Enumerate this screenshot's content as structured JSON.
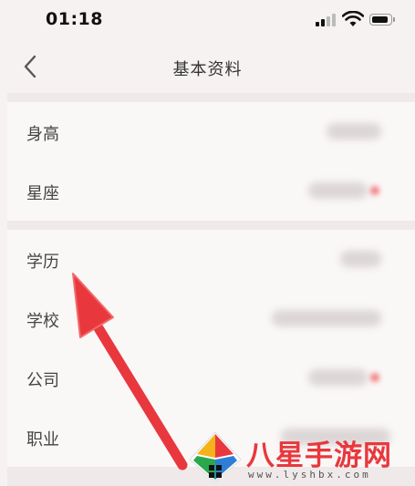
{
  "status_bar": {
    "time": "01:18"
  },
  "nav": {
    "title": "基本资料"
  },
  "rows": [
    {
      "label": "身高"
    },
    {
      "label": "星座"
    },
    {
      "label": "学历"
    },
    {
      "label": "学校"
    },
    {
      "label": "公司"
    },
    {
      "label": "职业"
    }
  ],
  "watermark": {
    "brand": "八星手游网",
    "url": "www.lyshbx.com"
  },
  "colors": {
    "accent_red": "#e8383d",
    "background": "#f6f2f2"
  }
}
